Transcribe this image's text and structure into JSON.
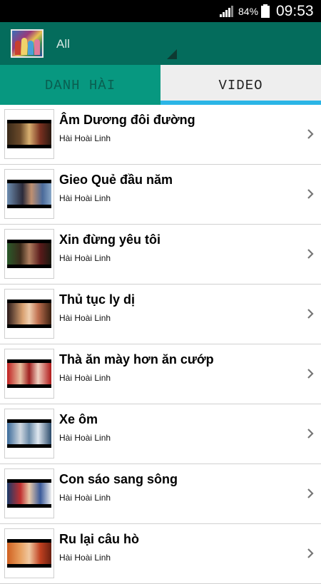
{
  "status_bar": {
    "battery_percent": "84%",
    "time": "09:53",
    "signal_icon": "signal-icon",
    "battery_icon": "battery-icon"
  },
  "app_bar": {
    "filter_value": "All",
    "logo_icon": "app-logo",
    "dropdown_icon": "dropdown-arrow-icon"
  },
  "tabs": [
    {
      "label": "DANH HÀI",
      "selected": false
    },
    {
      "label": "VIDEO",
      "selected": true
    }
  ],
  "accent_colors": {
    "app_bar": "#046c5c",
    "tab_inactive": "#079880",
    "tab_indicator": "#2bb5e6"
  },
  "videos": [
    {
      "title": "Âm Dương đôi đường",
      "artist": "Hài Hoài Linh"
    },
    {
      "title": "Gieo Quẻ đầu năm",
      "artist": "Hài Hoài Linh"
    },
    {
      "title": "Xin đừng yêu tôi",
      "artist": "Hài Hoài Linh"
    },
    {
      "title": "Thủ tục ly dị",
      "artist": "Hài Hoài Linh"
    },
    {
      "title": "Thà ăn mày hơn ăn cướp",
      "artist": "Hài Hoài Linh"
    },
    {
      "title": "Xe ôm",
      "artist": "Hài Hoài Linh"
    },
    {
      "title": "Con sáo sang sông",
      "artist": "Hài Hoài Linh"
    },
    {
      "title": "Ru lại câu hò",
      "artist": "Hài Hoài Linh"
    }
  ]
}
